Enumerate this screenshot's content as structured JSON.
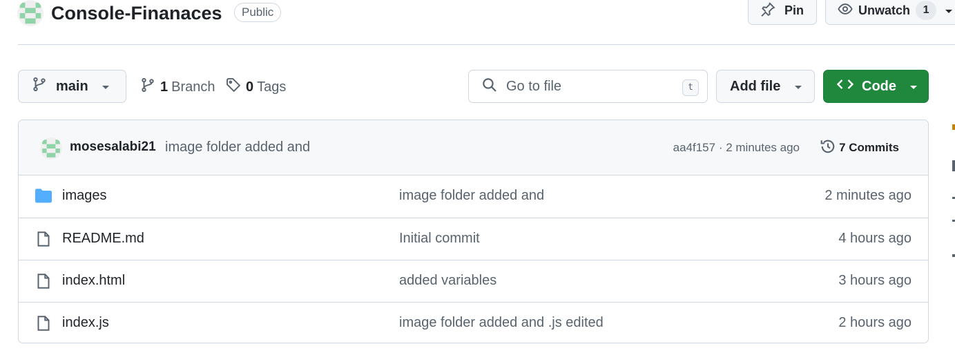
{
  "repo": {
    "name": "Console-Finanaces",
    "visibility": "Public"
  },
  "header_actions": {
    "pin_label": "Pin",
    "unwatch_label": "Unwatch",
    "watch_count": "1"
  },
  "toolbar": {
    "branch": "main",
    "branch_count": "1",
    "branch_word": "Branch",
    "tag_count": "0",
    "tag_word": "Tags",
    "search_placeholder": "Go to file",
    "search_shortcut": "t",
    "add_file_label": "Add file",
    "code_label": "Code"
  },
  "latest_commit": {
    "author": "mosesalabi21",
    "message": "image folder added and",
    "hash_time": "aa4f157 · 2 minutes ago",
    "commits_label": "7 Commits"
  },
  "files": [
    {
      "type": "folder",
      "icon": "folder-icon",
      "name": "images",
      "message": "image folder added and",
      "time": "2 minutes ago"
    },
    {
      "type": "file",
      "icon": "file-icon",
      "name": "README.md",
      "message": "Initial commit",
      "time": "4 hours ago"
    },
    {
      "type": "file",
      "icon": "file-icon",
      "name": "index.html",
      "message": "added variables",
      "time": "3 hours ago"
    },
    {
      "type": "file",
      "icon": "file-icon",
      "name": "index.js",
      "message": "image folder added and .js edited",
      "time": "2 hours ago"
    }
  ],
  "colors": {
    "accent_green": "#1f883d",
    "folder_blue": "#54aeff",
    "border": "#d0d7de",
    "muted_text": "#59636e"
  }
}
